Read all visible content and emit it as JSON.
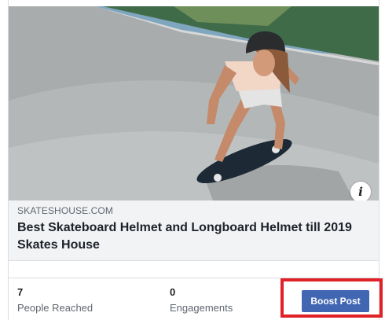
{
  "post": {
    "image_alt": "Woman riding a skateboard down a concrete bowl wearing a helmet",
    "info_glyph": "i",
    "link": {
      "domain": "SKATESHOUSE.COM",
      "title": "Best Skateboard Helmet and Longboard Helmet till 2019 Skates House"
    }
  },
  "insights": {
    "people_reached": {
      "value": "7",
      "label": "People Reached"
    },
    "engagements": {
      "value": "0",
      "label": "Engagements"
    }
  },
  "actions": {
    "boost_label": "Boost Post"
  },
  "colors": {
    "boost_bg": "#4267b2",
    "highlight": "#e02127"
  }
}
